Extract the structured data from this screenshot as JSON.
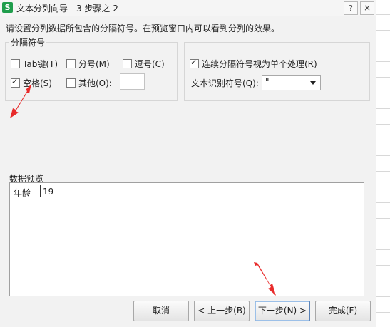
{
  "window": {
    "app_icon_letter": "S",
    "title": "文本分列向导 - 3 步骤之 2",
    "help_label": "?",
    "close_label": "×"
  },
  "instruction": "请设置分列数据所包含的分隔符号。在预览窗口内可以看到分列的效果。",
  "delimiters": {
    "group_title": "分隔符号",
    "tab": {
      "label": "Tab键(T)",
      "checked": false
    },
    "semicolon": {
      "label": "分号(M)",
      "checked": false
    },
    "comma": {
      "label": "逗号(C)",
      "checked": false
    },
    "space": {
      "label": "空格(S)",
      "checked": true
    },
    "other": {
      "label": "其他(O):",
      "checked": false,
      "value": ""
    }
  },
  "options": {
    "consecutive": {
      "label": "连续分隔符号视为单个处理(R)",
      "checked": true
    },
    "qualifier_label": "文本识别符号(Q):",
    "qualifier_value": "\""
  },
  "preview": {
    "title": "数据预览",
    "columns": [
      "年龄",
      "19"
    ]
  },
  "buttons": {
    "cancel": "取消",
    "back": "< 上一步(B)",
    "next": "下一步(N) >",
    "finish": "完成(F)"
  }
}
